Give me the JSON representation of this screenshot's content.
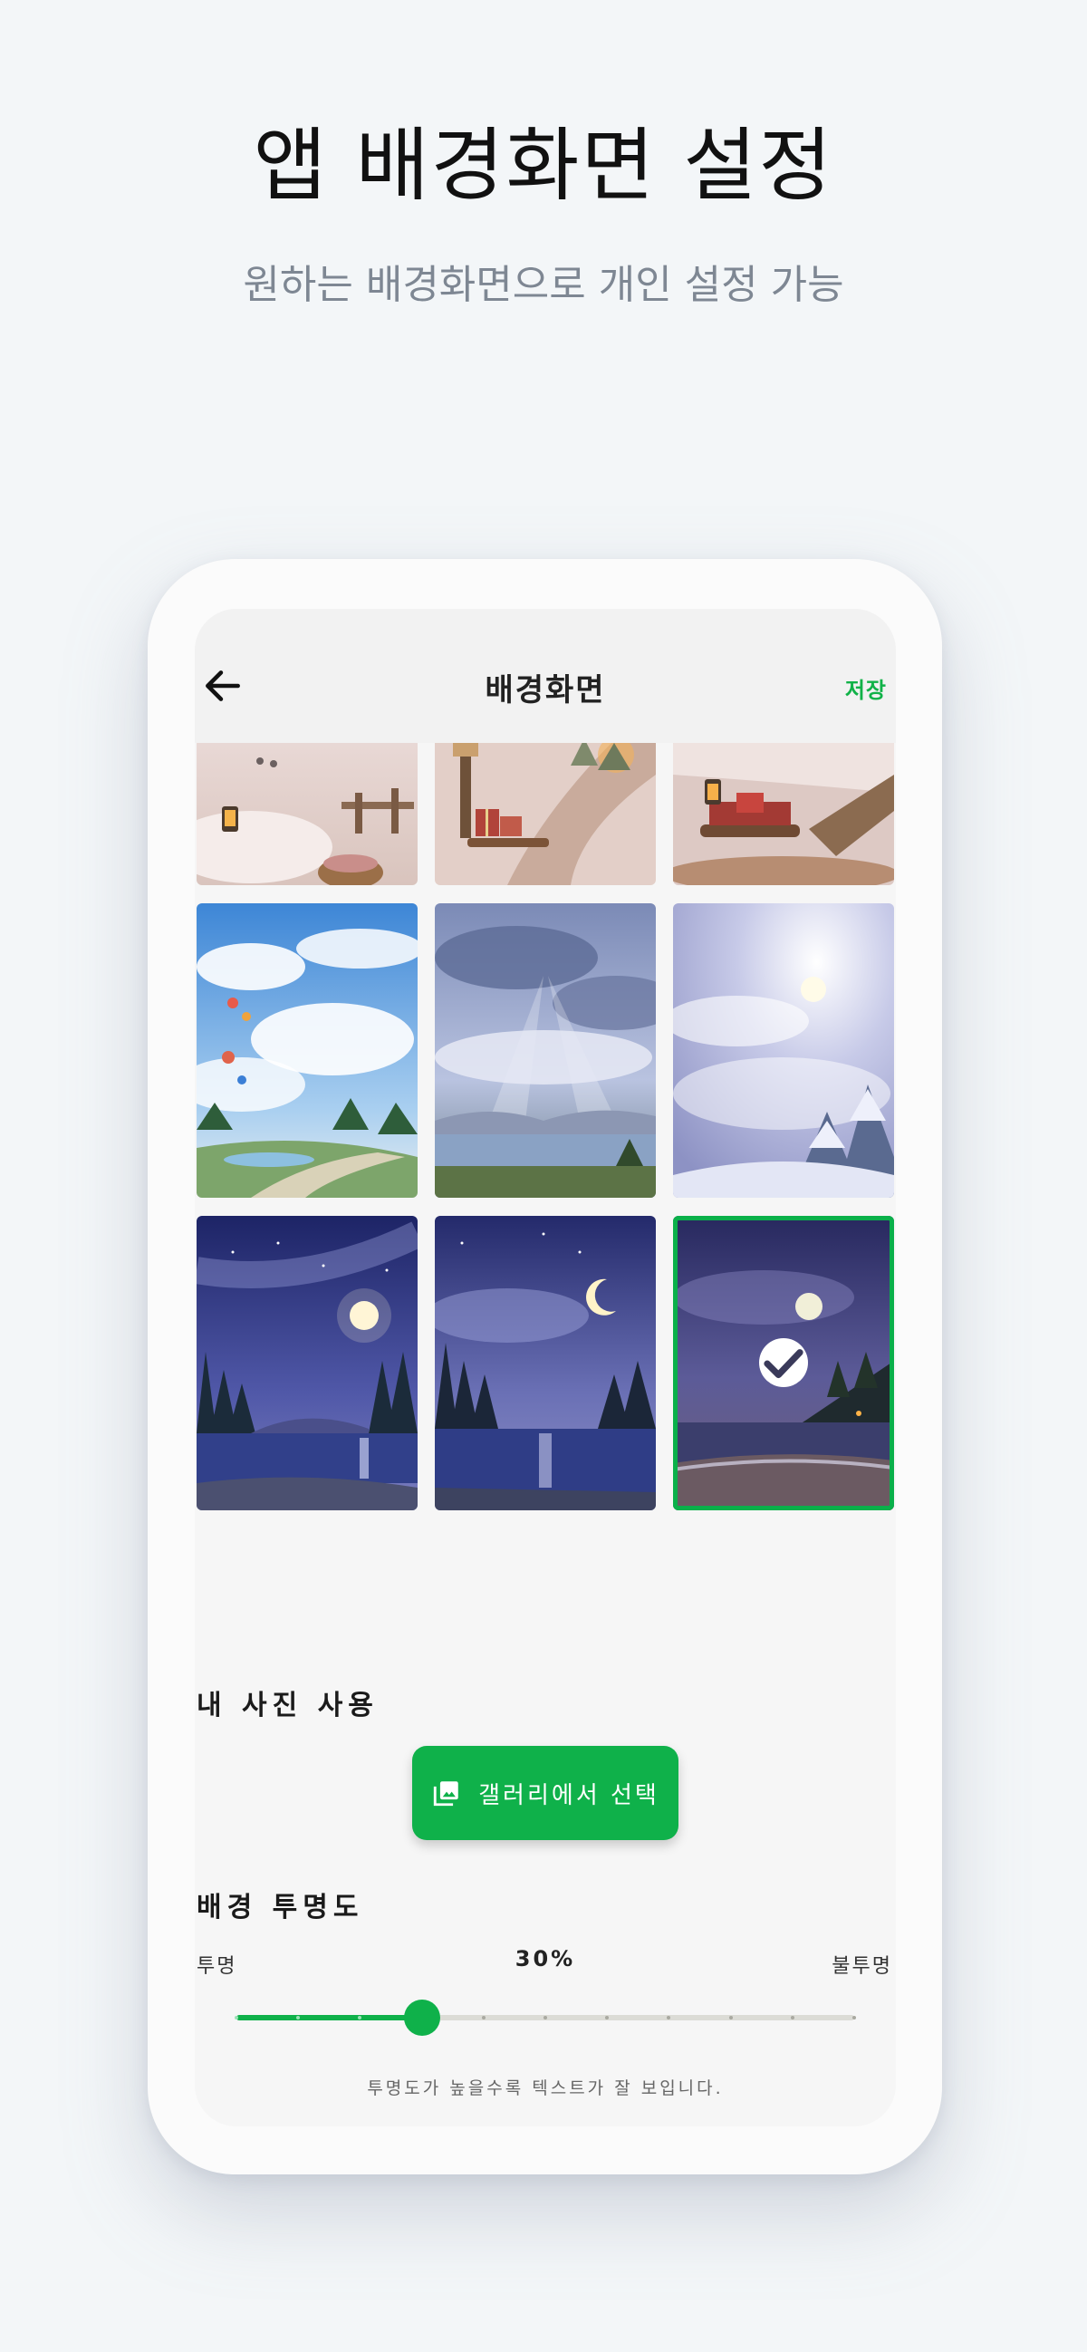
{
  "hero": {
    "title": "앱 배경화면 설정",
    "subtitle": "원하는 배경화면으로 개인 설정 가능"
  },
  "appbar": {
    "back_icon": "arrow-left-icon",
    "title": "배경화면",
    "save_label": "저장"
  },
  "wallpapers": [
    {
      "theme": "snowy-lantern-fence-basket",
      "selected": false
    },
    {
      "theme": "snowy-path-lamp-sled-gifts",
      "selected": false
    },
    {
      "theme": "snowy-bridge-sled-lantern",
      "selected": false
    },
    {
      "theme": "blue-sky-clouds-balloons",
      "selected": false
    },
    {
      "theme": "storm-clouds-sunrays-lake",
      "selected": false
    },
    {
      "theme": "snowfall-winter-forest",
      "selected": false
    },
    {
      "theme": "night-full-moon-lake",
      "selected": false
    },
    {
      "theme": "night-crescent-moon-lake",
      "selected": false
    },
    {
      "theme": "night-moon-beach",
      "selected": true
    }
  ],
  "my_photo": {
    "section_title": "내 사진 사용",
    "gallery_button": "갤러리에서 선택",
    "gallery_icon": "image-icon"
  },
  "opacity": {
    "section_title": "배경 투명도",
    "min_label": "투명",
    "max_label": "불투명",
    "value_label": "30%",
    "value": 0.3,
    "steps": 10,
    "hint": "투명도가 높을수록 텍스트가 잘 보입니다."
  },
  "colors": {
    "accent": "#0fb14a",
    "hero_title": "#111111",
    "hero_subtitle": "#7e8793",
    "page_background": "#f3f6f8"
  }
}
